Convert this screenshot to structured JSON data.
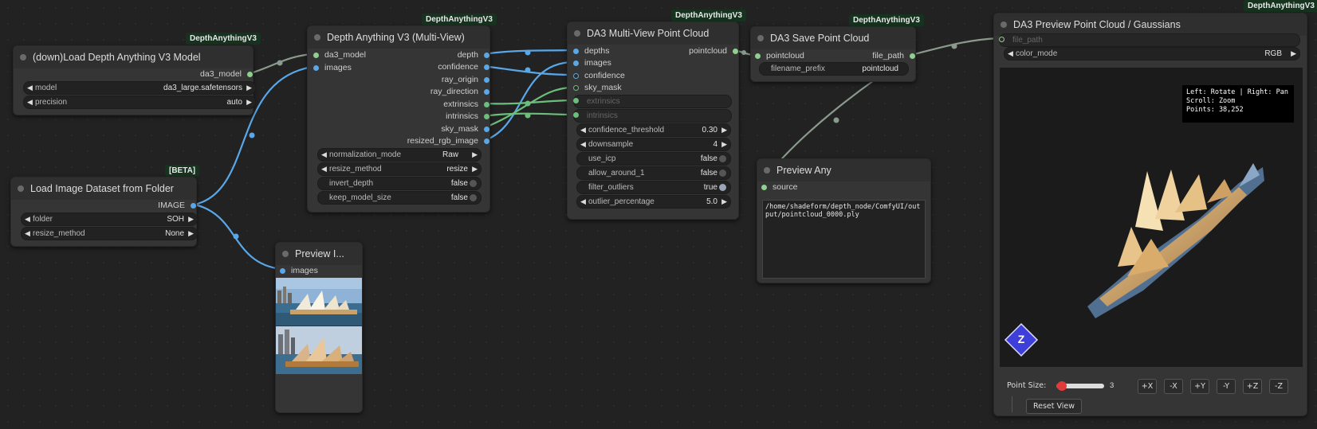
{
  "badges": {
    "load_model": "DepthAnythingV3",
    "depth_multi": "DepthAnythingV3",
    "da3_pointcloud": "DepthAnythingV3",
    "save_pointcloud": "DepthAnythingV3",
    "preview_pointcloud": "DepthAnythingV3",
    "load_images": "[BETA]"
  },
  "load_model_node": {
    "title": "(down)Load Depth Anything V3 Model",
    "output": "da3_model",
    "model_label": "model",
    "model_value": "da3_large.safetensors",
    "precision_label": "precision",
    "precision_value": "auto"
  },
  "load_images_node": {
    "title": "Load Image Dataset from Folder",
    "output": "IMAGE",
    "folder_label": "folder",
    "folder_value": "SOH",
    "resize_label": "resize_method",
    "resize_value": "None"
  },
  "depth_node": {
    "title": "Depth Anything V3 (Multi-View)",
    "inputs": [
      "da3_model",
      "images"
    ],
    "outputs": [
      "depth",
      "confidence",
      "ray_origin",
      "ray_direction",
      "extrinsics",
      "intrinsics",
      "sky_mask",
      "resized_rgb_image"
    ],
    "norm_label": "normalization_mode",
    "norm_value": "Raw",
    "resize_label": "resize_method",
    "resize_value": "resize",
    "invert_label": "invert_depth",
    "invert_value": "false",
    "keep_label": "keep_model_size",
    "keep_value": "false"
  },
  "preview_image_node": {
    "title": "Preview I...",
    "input": "images"
  },
  "pointcloud_node": {
    "title": "DA3 Multi-View Point Cloud",
    "inputs": [
      "depths",
      "images",
      "confidence",
      "sky_mask",
      "extrinsics",
      "intrinsics"
    ],
    "output": "pointcloud",
    "conf_label": "confidence_threshold",
    "conf_value": "0.30",
    "down_label": "downsample",
    "down_value": "4",
    "icp_label": "use_icp",
    "icp_value": "false",
    "around_label": "allow_around_1",
    "around_value": "false",
    "filter_label": "filter_outliers",
    "filter_value": "true",
    "outlier_label": "outlier_percentage",
    "outlier_value": "5.0"
  },
  "save_node": {
    "title": "DA3 Save Point Cloud",
    "input": "pointcloud",
    "output": "file_path",
    "prefix_label": "filename_prefix",
    "prefix_value": "pointcloud"
  },
  "preview_any_node": {
    "title": "Preview Any",
    "input": "source",
    "text": "/home/shadeform/depth_node/ComfyUI/output/pointcloud_0000.ply"
  },
  "preview_pc_node": {
    "title": "DA3 Preview Point Cloud / Gaussians",
    "input": "file_path",
    "color_label": "color_mode",
    "color_value": "RGB",
    "help_lines": [
      "Left: Rotate | Right: Pan",
      "Scroll: Zoom",
      "Points: 38,252"
    ],
    "gizmo_label": "Z",
    "point_size_label": "Point Size:",
    "point_size_value": "3",
    "point_size_fraction": 0.05,
    "axis_buttons": [
      "+X",
      "-X",
      "+Y",
      "-Y",
      "+Z",
      "-Z"
    ],
    "reset_label": "Reset View"
  },
  "colors": {
    "wire_blue": "#5aa7e8",
    "wire_gray": "#8a9a8c",
    "wire_green": "#6cbf7b",
    "badge_bg": "#16331f",
    "node_bg": "#353535"
  }
}
